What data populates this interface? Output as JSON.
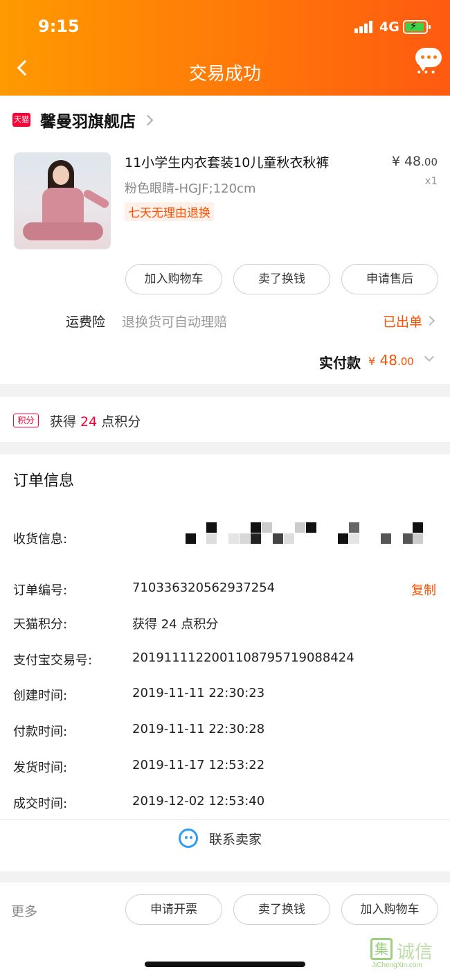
{
  "status_bar": {
    "time": "9:15",
    "network": "4G"
  },
  "nav": {
    "title": "交易成功"
  },
  "shop": {
    "badge": "天猫",
    "name": "馨曼羽旗舰店"
  },
  "product": {
    "title": "11小学生内衣套装10儿童秋衣秋裤",
    "price_main": "¥ 48",
    "price_cents": ".00",
    "sku": "粉色眼睛-HGJF;120cm",
    "quantity": "x1",
    "tag": "七天无理由退换"
  },
  "product_actions": [
    "加入购物车",
    "卖了换钱",
    "申请售后"
  ],
  "insurance": {
    "label": "运费险",
    "desc": "退换货可自动理赔",
    "status": "已出单"
  },
  "payment": {
    "label": "实付款",
    "currency": "¥",
    "amount_main": " 48",
    "amount_cents": ".00"
  },
  "points": {
    "badge": "积分",
    "prefix": "获得 ",
    "value": "24",
    "suffix": " 点积分"
  },
  "order_info": {
    "heading": "订单信息",
    "shipping_label": "收货信息:",
    "copy_label": "复制",
    "rows": [
      {
        "label": "订单编号:",
        "value": "710336320562937254"
      },
      {
        "label": "天猫积分:",
        "value": "获得 24 点积分"
      },
      {
        "label": "支付宝交易号:",
        "value": "2019111122001108795719088424"
      },
      {
        "label": "创建时间:",
        "value": "2019-11-11 22:30:23"
      },
      {
        "label": "付款时间:",
        "value": "2019-11-11 22:30:28"
      },
      {
        "label": "发货时间:",
        "value": "2019-11-17 12:53:22"
      },
      {
        "label": "成交时间:",
        "value": "2019-12-02 12:53:40"
      }
    ]
  },
  "contact": {
    "label": "联系卖家"
  },
  "bottom_bar": {
    "more_label": "更多",
    "actions": [
      "申请开票",
      "卖了换钱",
      "加入购物车"
    ]
  },
  "watermark": {
    "mark": "集",
    "text": "诚信",
    "url": "JiChengXin.com"
  },
  "colors": {
    "header_start": "#ff9a00",
    "header_end": "#ff5a10",
    "accent": "#ff5000",
    "tmall_red": "#ff0036",
    "contact_blue": "#2d9df5"
  },
  "icons": [
    "back-icon",
    "chat-icon",
    "chevron-right-icon",
    "chevron-down-icon",
    "contact-seller-icon"
  ]
}
